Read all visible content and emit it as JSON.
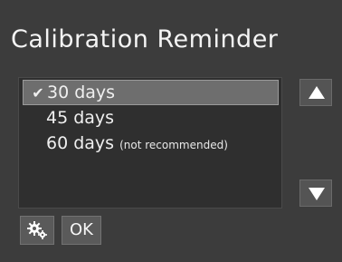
{
  "dialog": {
    "title": "Calibration Reminder"
  },
  "options": [
    {
      "label": "30 days",
      "note": "",
      "selected": true
    },
    {
      "label": "45 days",
      "note": "",
      "selected": false
    },
    {
      "label": "60 days",
      "note": "(not recommended)",
      "selected": false
    }
  ],
  "check_glyph": "✔",
  "buttons": {
    "ok_label": "OK",
    "settings_icon": "gears-icon",
    "scroll_up_icon": "triangle-up-icon",
    "scroll_down_icon": "triangle-down-icon"
  },
  "colors": {
    "background": "#3c3c3c",
    "selection": "#6e6e6e",
    "text": "#f2f2f2"
  }
}
